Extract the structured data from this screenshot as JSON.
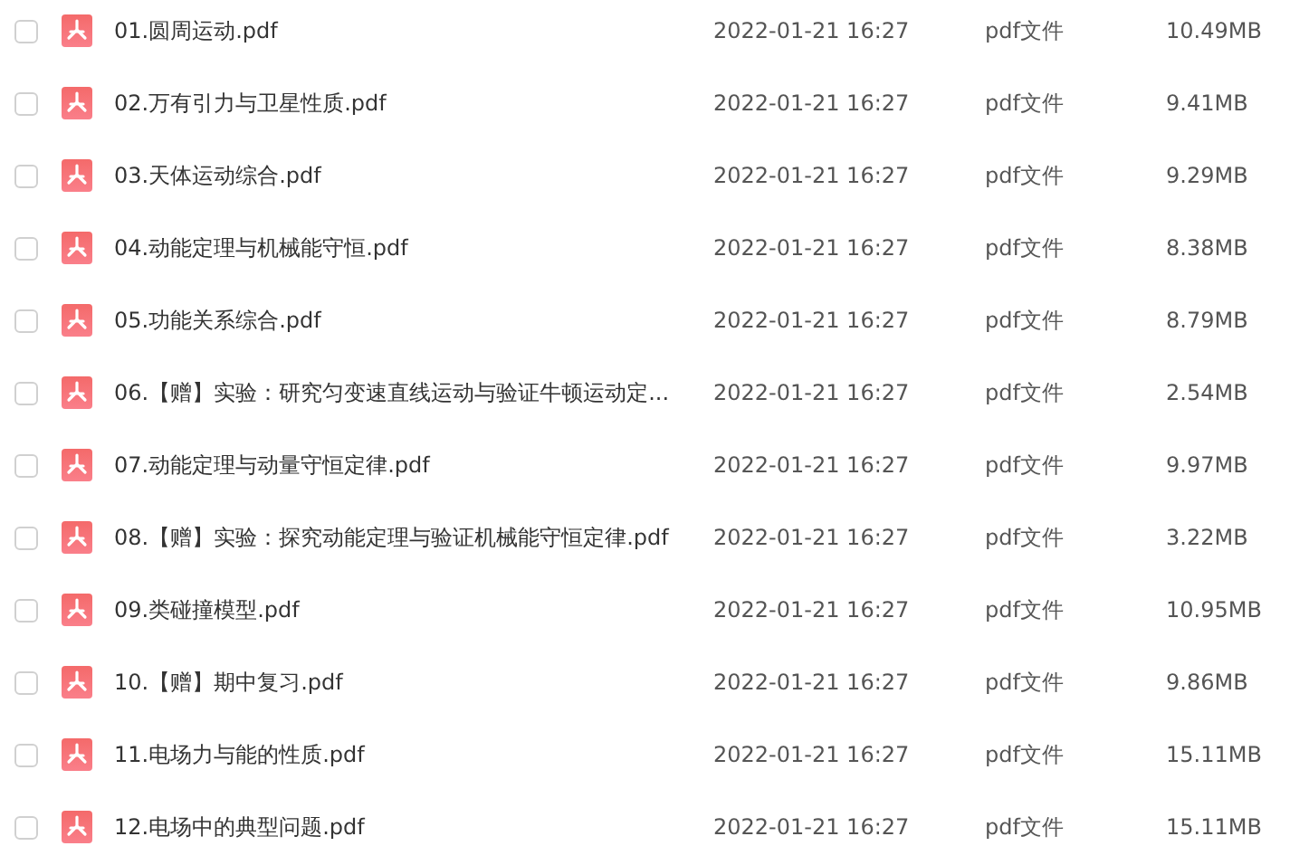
{
  "files": [
    {
      "name": "01.圆周运动.pdf",
      "checked": false,
      "date": "2022-01-21 16:27",
      "type": "pdf文件",
      "size": "10.49MB"
    },
    {
      "name": "02.万有引力与卫星性质.pdf",
      "checked": false,
      "date": "2022-01-21 16:27",
      "type": "pdf文件",
      "size": "9.41MB"
    },
    {
      "name": "03.天体运动综合.pdf",
      "checked": false,
      "date": "2022-01-21 16:27",
      "type": "pdf文件",
      "size": "9.29MB"
    },
    {
      "name": "04.动能定理与机械能守恒.pdf",
      "checked": false,
      "date": "2022-01-21 16:27",
      "type": "pdf文件",
      "size": "8.38MB"
    },
    {
      "name": "05.功能关系综合.pdf",
      "checked": false,
      "date": "2022-01-21 16:27",
      "type": "pdf文件",
      "size": "8.79MB"
    },
    {
      "name": "06.【赠】实验：研究匀变速直线运动与验证牛顿运动定...",
      "checked": false,
      "date": "2022-01-21 16:27",
      "type": "pdf文件",
      "size": "2.54MB"
    },
    {
      "name": "07.动能定理与动量守恒定律.pdf",
      "checked": false,
      "date": "2022-01-21 16:27",
      "type": "pdf文件",
      "size": "9.97MB"
    },
    {
      "name": "08.【赠】实验：探究动能定理与验证机械能守恒定律.pdf",
      "checked": false,
      "date": "2022-01-21 16:27",
      "type": "pdf文件",
      "size": "3.22MB"
    },
    {
      "name": "09.类碰撞模型.pdf",
      "checked": false,
      "date": "2022-01-21 16:27",
      "type": "pdf文件",
      "size": "10.95MB"
    },
    {
      "name": "10.【赠】期中复习.pdf",
      "checked": false,
      "date": "2022-01-21 16:27",
      "type": "pdf文件",
      "size": "9.86MB"
    },
    {
      "name": "11.电场力与能的性质.pdf",
      "checked": false,
      "date": "2022-01-21 16:27",
      "type": "pdf文件",
      "size": "15.11MB"
    },
    {
      "name": "12.电场中的典型问题.pdf",
      "checked": false,
      "date": "2022-01-21 16:27",
      "type": "pdf文件",
      "size": "15.11MB"
    }
  ]
}
